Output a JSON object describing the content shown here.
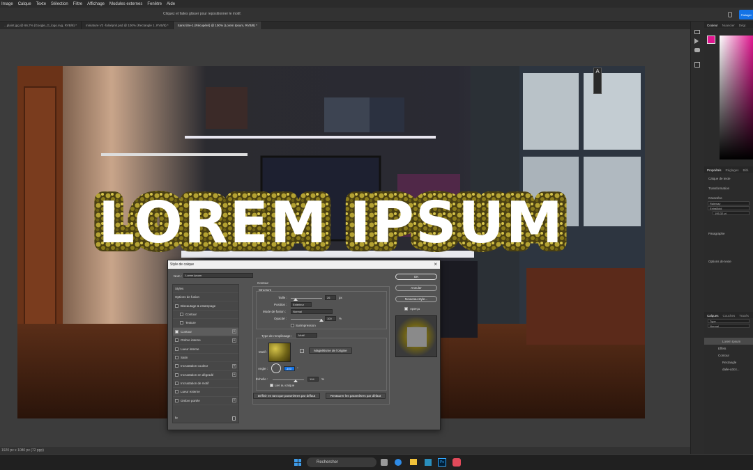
{
  "menu": [
    "Image",
    "Calque",
    "Texte",
    "Sélection",
    "Filtre",
    "Affichage",
    "Modules externes",
    "Fenêtre",
    "Aide"
  ],
  "options_bar": {
    "hint": "Cliquez et faites glisser pour repositionner le motif.",
    "share_label": "Partager"
  },
  "tabs": [
    {
      "label": "...plaint.jpg @ 66,7% (Google_G_logo.svg, RVB/8) *",
      "active": false
    },
    {
      "label": "miniature V2 -falsépnlr.psd @ 100% (Rectangle 1, RVB/8) *",
      "active": false
    },
    {
      "label": "Sans titre-1 (Récupéré) @ 100% (Lorem Ipsum, RVB/8) *",
      "active": true
    }
  ],
  "canvas": {
    "headline": "LOREM IPSUM"
  },
  "status_bar": {
    "text": "1920 px x 1080 px (72 ppp)"
  },
  "right_panel": {
    "color_tabs": [
      "Couleur",
      "Nuancier",
      "Dégr."
    ],
    "prop_tabs": [
      "Propriétés",
      "Réglages",
      "Bibl."
    ],
    "layer_type": "Calque de texte",
    "transform": "Transformation",
    "character": "Caractère",
    "font": "Raleway",
    "font_style": "ExtraBold",
    "font_size": "195,32 pt",
    "paragraph": "Paragraphe",
    "text_options": "Options de texte",
    "layer_tabs": [
      "Calques",
      "Couches",
      "Tracés"
    ],
    "search": "Type",
    "blend": "Normal",
    "layers": [
      {
        "name": "Lorem Ipsum",
        "active": true
      },
      {
        "name": "Effets",
        "active": false
      },
      {
        "name": "Contour",
        "active": false
      },
      {
        "name": "Rectangle",
        "active": false
      },
      {
        "name": "dalle-a3c4...",
        "active": false
      }
    ]
  },
  "dialog": {
    "title": "Style de calque",
    "name_label": "Nom :",
    "name_value": "Lorem Ipsum",
    "styles_header": "Styles",
    "styles": [
      {
        "label": "Options de fusion",
        "check": false,
        "plus": false,
        "indent": false,
        "active": false,
        "nochk": true
      },
      {
        "label": "Biseautage & estampage",
        "check": false,
        "plus": false,
        "indent": false,
        "active": false,
        "nochk": false
      },
      {
        "label": "Contour",
        "check": false,
        "plus": false,
        "indent": true,
        "active": false,
        "nochk": false
      },
      {
        "label": "Texture",
        "check": false,
        "plus": false,
        "indent": true,
        "active": false,
        "nochk": false
      },
      {
        "label": "Contour",
        "check": true,
        "plus": true,
        "indent": false,
        "active": true,
        "nochk": false
      },
      {
        "label": "Ombre interne",
        "check": false,
        "plus": true,
        "indent": false,
        "active": false,
        "nochk": false
      },
      {
        "label": "Lueur interne",
        "check": false,
        "plus": false,
        "indent": false,
        "active": false,
        "nochk": false
      },
      {
        "label": "Satin",
        "check": false,
        "plus": false,
        "indent": false,
        "active": false,
        "nochk": false
      },
      {
        "label": "Incrustation couleur",
        "check": false,
        "plus": true,
        "indent": false,
        "active": false,
        "nochk": false
      },
      {
        "label": "Incrustation en dégradé",
        "check": false,
        "plus": true,
        "indent": false,
        "active": false,
        "nochk": false
      },
      {
        "label": "Incrustation de motif",
        "check": false,
        "plus": false,
        "indent": false,
        "active": false,
        "nochk": false
      },
      {
        "label": "Lueur externe",
        "check": false,
        "plus": false,
        "indent": false,
        "active": false,
        "nochk": false
      },
      {
        "label": "Ombre portée",
        "check": false,
        "plus": true,
        "indent": false,
        "active": false,
        "nochk": false
      }
    ],
    "section_title": "Contour",
    "structure_title": "Structure",
    "size_label": "Taille :",
    "size_value": "26",
    "size_unit": "px",
    "position_label": "Position :",
    "position_value": "Extérieur",
    "blend_label": "Mode de fusion :",
    "blend_value": "Normal",
    "opacity_label": "Opacité :",
    "opacity_value": "100",
    "opacity_unit": "%",
    "overprint_label": "Surimpression",
    "fill_type_label": "Type de remplissage :",
    "fill_type_value": "Motif",
    "pattern_label": "Motif :",
    "snap_label": "Magnétisme de l'origine",
    "angle_label": "Angle :",
    "angle_value": "-103",
    "angle_unit": "°",
    "scale_label": "Échelle :",
    "scale_value": "194",
    "scale_unit": "%",
    "link_label": "Lier au calque",
    "default_set": "Définir en tant que paramètres par défaut",
    "default_reset": "Restaurer les paramètres par défaut",
    "ok": "OK",
    "cancel": "Annuler",
    "new_style": "Nouveau style...",
    "preview": "Aperçu",
    "fx": "fx"
  },
  "taskbar": {
    "search": "Rechercher"
  },
  "colors": {
    "accent": "#1473e6",
    "foreground_swatch": "#e0168f",
    "headline_fill": "#ffffff",
    "pattern_gold": "#9b8a1e"
  }
}
